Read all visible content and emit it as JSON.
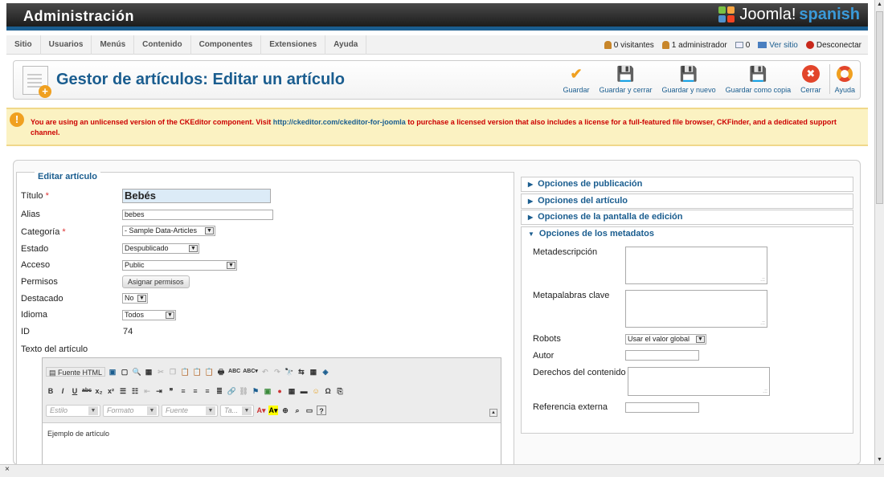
{
  "header": {
    "title": "Administración",
    "logo_joomla": "Joomla!",
    "logo_lang": "spanish"
  },
  "menu": [
    "Sitio",
    "Usuarios",
    "Menús",
    "Contenido",
    "Componentes",
    "Extensiones",
    "Ayuda"
  ],
  "status": {
    "visitors": "0 visitantes",
    "admins": "1 administrador",
    "messages": "0",
    "view_site": "Ver sitio",
    "logout": "Desconectar"
  },
  "toolbar": {
    "title": "Gestor de artículos: Editar un artículo",
    "buttons": [
      "Guardar",
      "Guardar y cerrar",
      "Guardar y nuevo",
      "Guardar como copia",
      "Cerrar",
      "Ayuda"
    ]
  },
  "warning": {
    "before": "You are using an unlicensed version of the CKEditor component. Visit ",
    "link": "http://ckeditor.com/ckeditor-for-joomla",
    "after": " to purchase a licensed version that also includes a license for a full-featured file browser, CKFinder, and a dedicated support channel."
  },
  "form": {
    "legend": "Editar artículo",
    "title_label": "Título",
    "title_value": "Bebés",
    "alias_label": "Alias",
    "alias_value": "bebes",
    "category_label": "Categoría",
    "category_value": "- Sample Data-Articles",
    "state_label": "Estado",
    "state_value": "Despublicado",
    "access_label": "Acceso",
    "access_value": "Public",
    "perms_label": "Permisos",
    "perms_button": "Asignar permisos",
    "featured_label": "Destacado",
    "featured_value": "No",
    "lang_label": "Idioma",
    "lang_value": "Todos",
    "id_label": "ID",
    "id_value": "74",
    "text_label": "Texto del artículo"
  },
  "editor": {
    "source": "Fuente HTML",
    "style": "Estilo",
    "format": "Formato",
    "font": "Fuente",
    "size": "Ta...",
    "content": "Ejemplo de artículo"
  },
  "panels": [
    "Opciones de publicación",
    "Opciones del artículo",
    "Opciones de la pantalla de edición",
    "Opciones de los metadatos"
  ],
  "meta": {
    "desc": "Metadescripción",
    "keys": "Metapalabras clave",
    "robots": "Robots",
    "robots_value": "Usar el valor global",
    "author": "Autor",
    "rights": "Derechos del contenido",
    "xref": "Referencia externa"
  },
  "bottom": "×"
}
